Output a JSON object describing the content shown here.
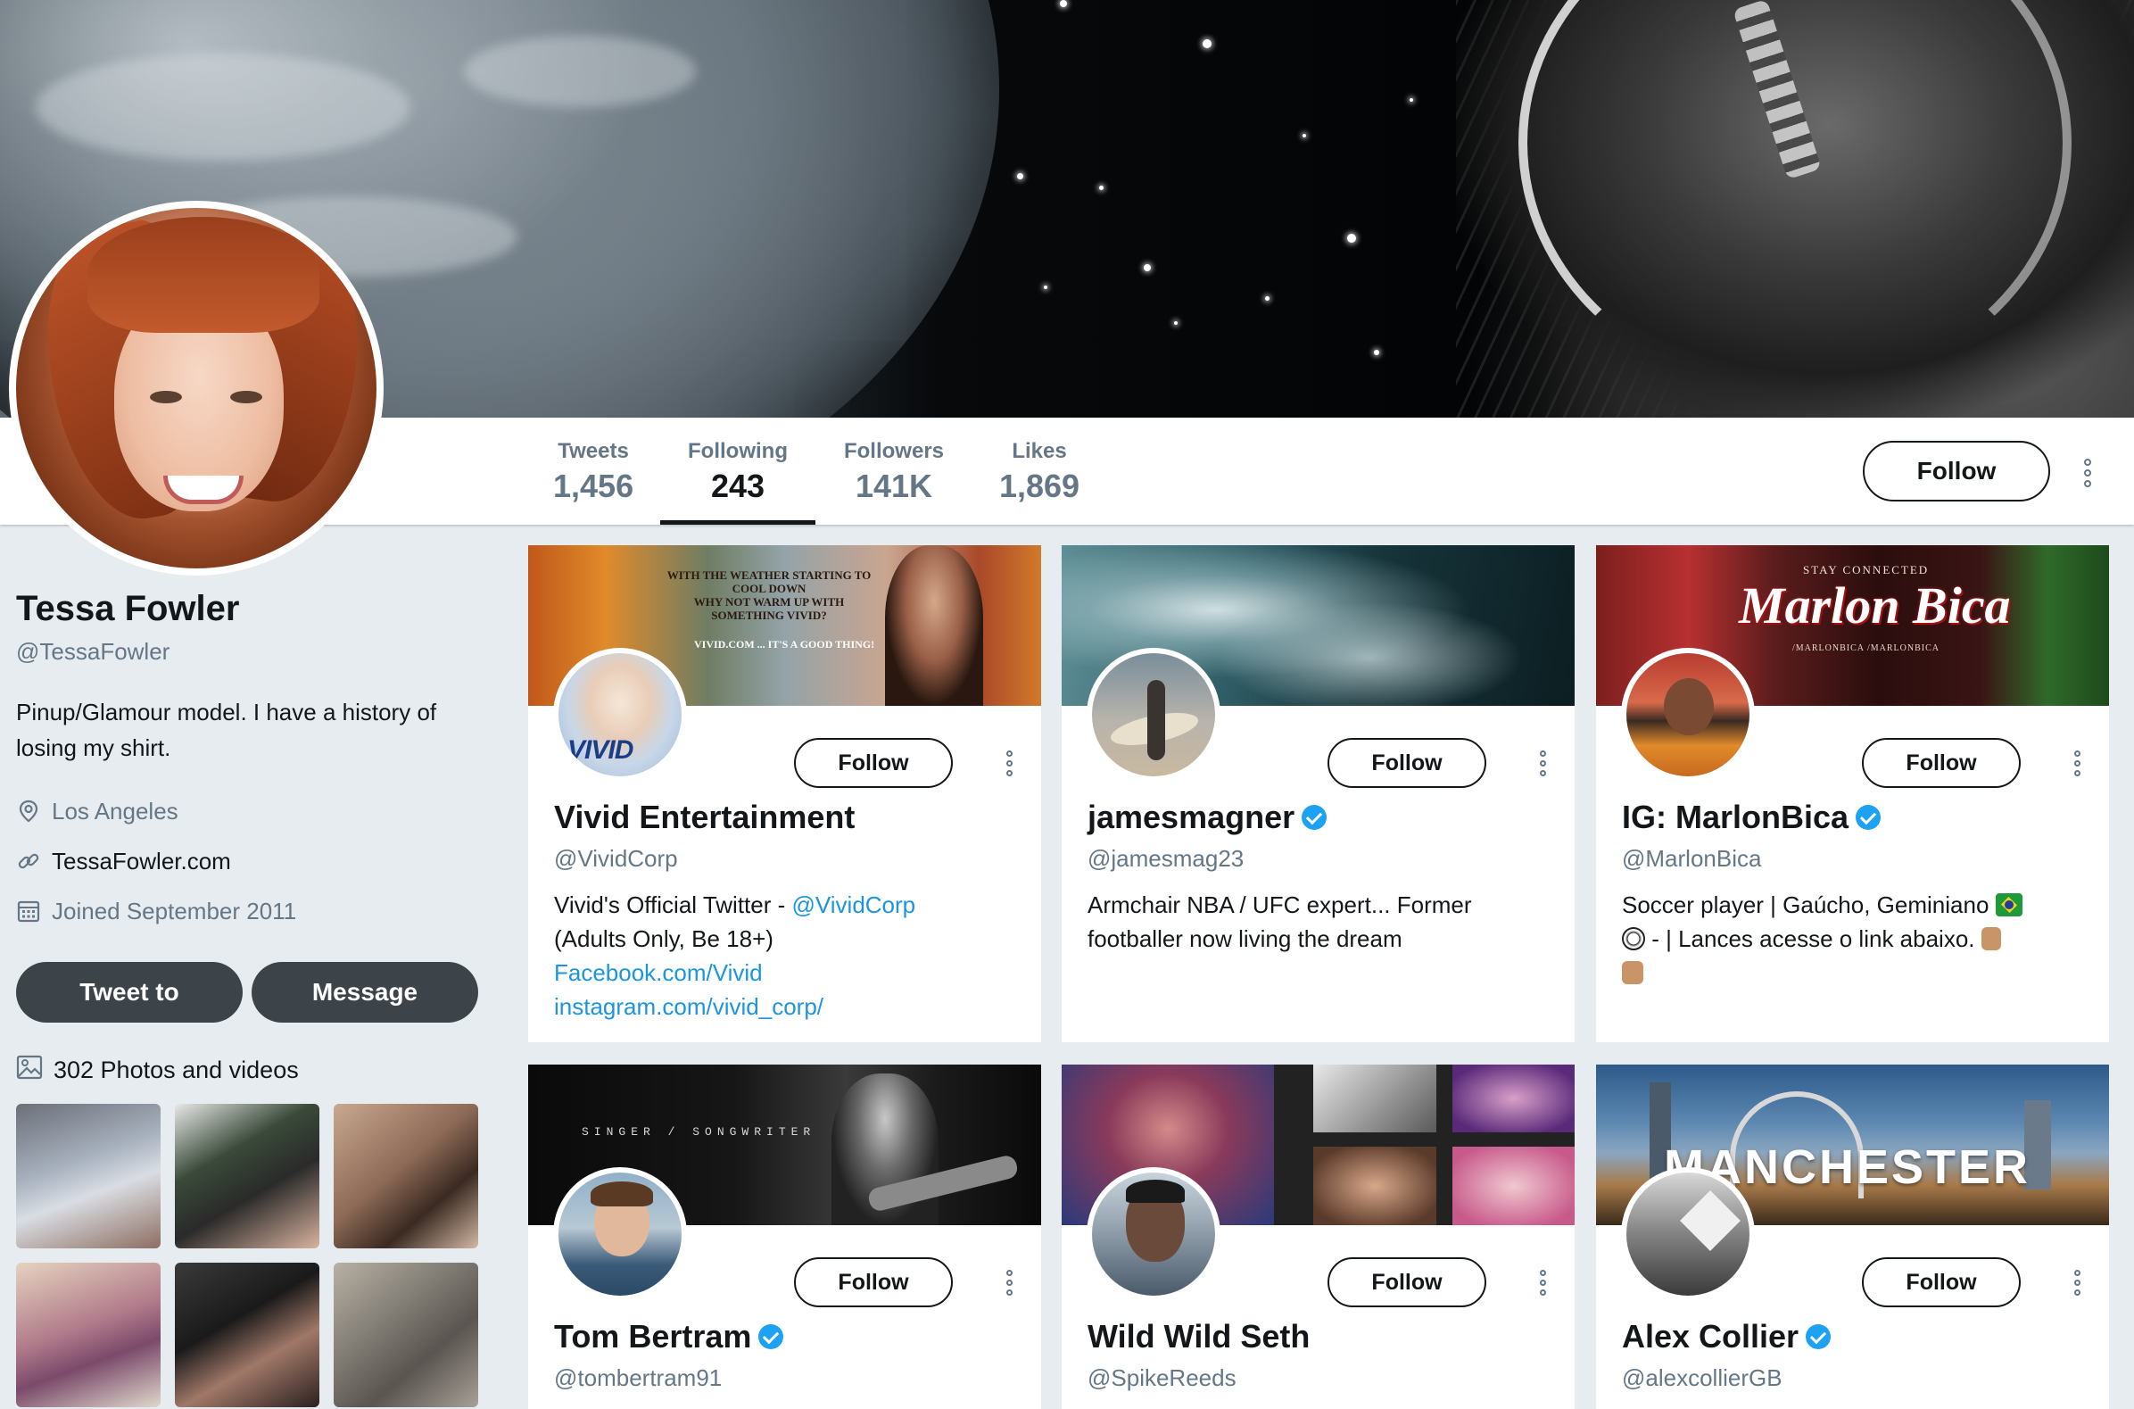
{
  "profile": {
    "name": "Tessa Fowler",
    "handle": "@TessaFowler",
    "bio": "Pinup/Glamour model. I have a history of losing my shirt.",
    "location": "Los Angeles",
    "website": "TessaFowler.com",
    "joined": "Joined September 2011",
    "tweet_to_label": "Tweet to",
    "message_label": "Message",
    "photos_label": "302 Photos and videos"
  },
  "stats": [
    {
      "label": "Tweets",
      "value": "1,456"
    },
    {
      "label": "Following",
      "value": "243"
    },
    {
      "label": "Followers",
      "value": "141K"
    },
    {
      "label": "Likes",
      "value": "1,869"
    }
  ],
  "navbar": {
    "follow_label": "Follow"
  },
  "cards": [
    {
      "name": "Vivid Entertainment",
      "handle": "@VividCorp",
      "verified": false,
      "follow_label": "Follow",
      "bio_text": "Vivid's Official Twitter - ",
      "bio_mention": "@VividCorp",
      "bio_text2": "(Adults Only, Be 18+)",
      "bio_link1": "Facebook.com/Vivid",
      "bio_link2": "instagram.com/vivid_corp/",
      "banner_text1": "WITH THE WEATHER STARTING TO COOL DOWN",
      "banner_text2": "WHY NOT WARM UP WITH SOMETHING VIVID?",
      "banner_text3": "VIVID.COM ... IT'S A GOOD THING!",
      "avatar_text": "VIVID"
    },
    {
      "name": "jamesmagner",
      "handle": "@jamesmag23",
      "verified": true,
      "follow_label": "Follow",
      "bio": "Armchair NBA / UFC expert... Former footballer now living the dream"
    },
    {
      "name": "IG: MarlonBica",
      "handle": "@MarlonBica",
      "verified": true,
      "follow_label": "Follow",
      "bio_text": "Soccer player | Gaúcho, Geminiano",
      "bio_text2": " - | Lances acesse o link abaixo.",
      "banner_top": "STAY CONNECTED",
      "banner_title": "Marlon Bica",
      "banner_bottom": "/MARLONBICA  /MARLONBICA"
    },
    {
      "name": "Tom Bertram",
      "handle": "@tombertram91",
      "verified": true,
      "follow_label": "Follow",
      "banner_text": "SINGER / SONGWRITER"
    },
    {
      "name": "Wild Wild Seth",
      "handle": "@SpikeReeds",
      "verified": false,
      "follow_label": "Follow"
    },
    {
      "name": "Alex Collier",
      "handle": "@alexcollierGB",
      "verified": true,
      "follow_label": "Follow",
      "banner_text": "MANCHESTER"
    }
  ],
  "colors": {
    "link": "#1b95e0",
    "verified": "#1da1f2",
    "text_gray": "#657786",
    "button_dark": "#3d4449",
    "page_bg": "#e6ecf0"
  },
  "icons": [
    "location-icon",
    "link-icon",
    "calendar-icon",
    "photo-icon",
    "verified-icon",
    "more-icon"
  ]
}
